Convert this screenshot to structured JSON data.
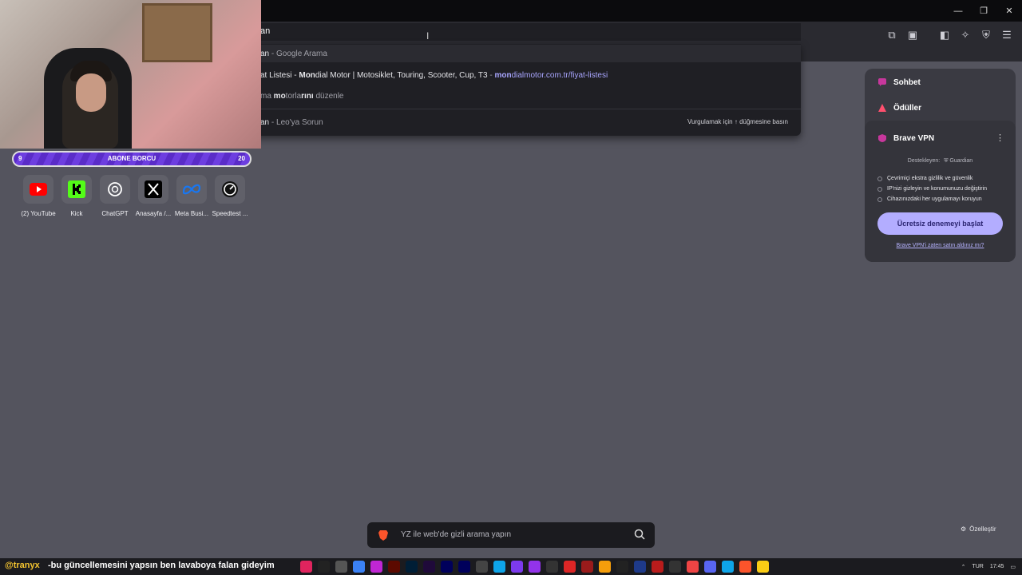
{
  "omnibox": {
    "typed": "an"
  },
  "suggestions": [
    {
      "main": "an",
      "suffix": " - Google Arama"
    },
    {
      "pre": "at Listesi - ",
      "bold": "Mon",
      "rest": "dial Motor | Motosiklet, Touring, Scooter, Cup, T3",
      "sep": " - ",
      "url_bold": "mon",
      "url_rest": "dialmotor.com.tr/fiyat-listesi"
    },
    {
      "pre": "ma ",
      "bold": "mo",
      "rest": "torla",
      "bold2": "rını",
      "rest2": " düzenle"
    },
    {
      "main": "an",
      "suffix": " - Leo'ya Sorun"
    }
  ],
  "dropdown_hint": "Vurgulamak için ↑ düğmesine basın",
  "subbar": {
    "left": "9",
    "label": "ABONE BORCU",
    "right": "20"
  },
  "shortcuts": [
    {
      "label": "(2) YouTube",
      "icon": "youtube-icon"
    },
    {
      "label": "Kick",
      "icon": "kick-icon"
    },
    {
      "label": "ChatGPT",
      "icon": "chatgpt-icon"
    },
    {
      "label": "Anasayfa /...",
      "icon": "x-icon"
    },
    {
      "label": "Meta Busi...",
      "icon": "meta-icon"
    },
    {
      "label": "Speedtest ...",
      "icon": "speedtest-icon"
    }
  ],
  "panel": {
    "chat": "Sohbet",
    "rewards": "Ödüller",
    "vpn_title": "Brave VPN",
    "sponsor": "Destekleyen:",
    "sponsor_brand": "Guardian",
    "features": [
      "Çevrimiçi ekstra gizlilik ve güvenlik",
      "IP'nizi gizleyin ve konumunuzu değiştirin",
      "Cihazınızdaki her uygulamayı koruyun"
    ],
    "trial_button": "Ücretsiz denemeyi başlat",
    "already_link": "Brave VPN'i zaten satın aldınız mı?"
  },
  "searchbar": {
    "placeholder": "YZ ile web'de gizli arama yapın"
  },
  "customize": "Özelleştir",
  "ticker": {
    "user": "@tranyx",
    "message": "-bu güncellemesini yapsın ben lavaboya falan gideyim"
  },
  "tray": {
    "lang": "TUR",
    "time": "17:45"
  },
  "colors": {
    "accent": "#b3adff",
    "bg": "#54545e",
    "panel": "#3a3a42"
  }
}
